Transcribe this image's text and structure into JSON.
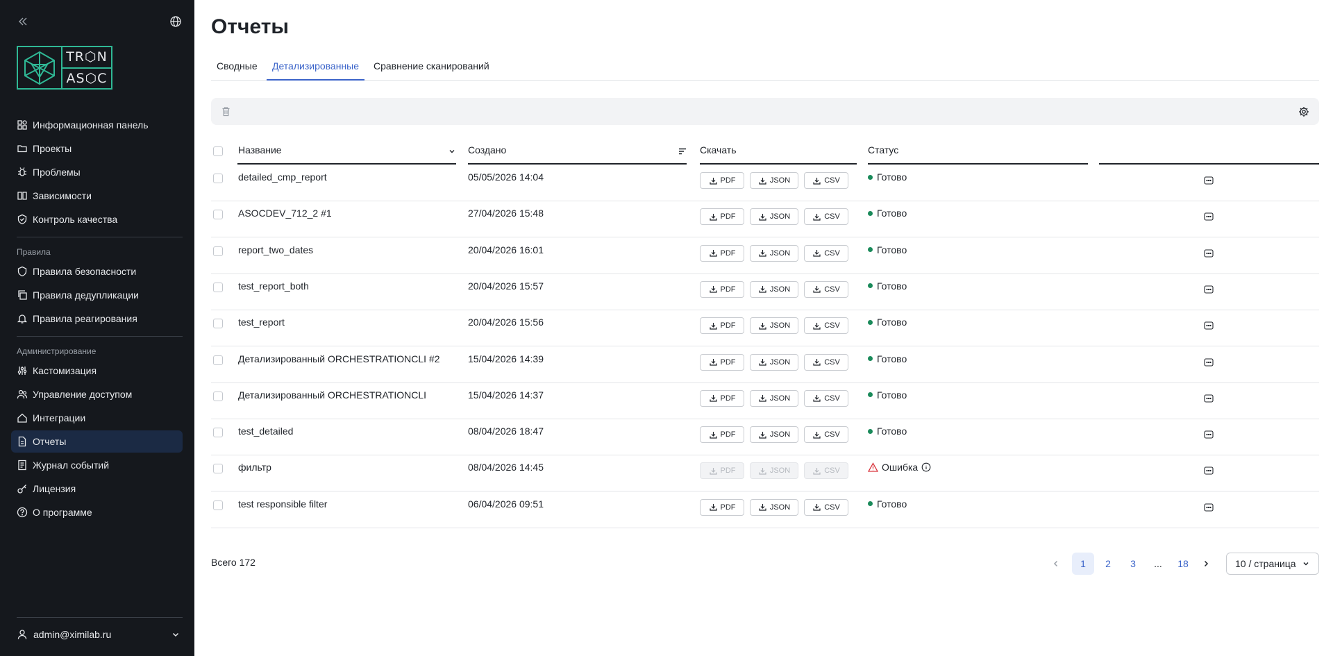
{
  "sidebar": {
    "logo": {
      "line1": "TR⬡N",
      "line2": "AS⬡C"
    },
    "items": [
      {
        "label": "Информационная панель",
        "icon": "dashboard-icon"
      },
      {
        "label": "Проекты",
        "icon": "folder-icon"
      },
      {
        "label": "Проблемы",
        "icon": "bug-icon"
      },
      {
        "label": "Зависимости",
        "icon": "book-icon"
      },
      {
        "label": "Контроль качества",
        "icon": "shield-check-icon"
      }
    ],
    "rules_section": "Правила",
    "rules": [
      {
        "label": "Правила безопасности",
        "icon": "shield-icon"
      },
      {
        "label": "Правила дедупликации",
        "icon": "copy-icon"
      },
      {
        "label": "Правила реагирования",
        "icon": "bell-icon"
      }
    ],
    "admin_section": "Администрирование",
    "admin": [
      {
        "label": "Кастомизация",
        "icon": "sliders-icon"
      },
      {
        "label": "Управление доступом",
        "icon": "users-icon"
      },
      {
        "label": "Интеграции",
        "icon": "home-icon"
      },
      {
        "label": "Отчеты",
        "icon": "report-icon",
        "active": true
      },
      {
        "label": "Журнал событий",
        "icon": "journal-icon"
      },
      {
        "label": "Лицензия",
        "icon": "key-icon"
      },
      {
        "label": "О программе",
        "icon": "help-icon"
      }
    ],
    "user": "admin@ximilab.ru"
  },
  "page": {
    "title": "Отчеты",
    "tabs": [
      "Сводные",
      "Детализированные",
      "Сравнение сканирований"
    ],
    "active_tab": 1
  },
  "table": {
    "headers": {
      "name": "Название",
      "created": "Создано",
      "download": "Скачать",
      "status": "Статус"
    },
    "download_labels": {
      "pdf": "PDF",
      "json": "JSON",
      "csv": "CSV"
    },
    "rows": [
      {
        "name": "detailed_cmp_report",
        "created": "05/05/2026 14:04",
        "status": "Готово",
        "ok": true
      },
      {
        "name": "ASOCDEV_712_2 #1",
        "created": "27/04/2026 15:48",
        "status": "Готово",
        "ok": true
      },
      {
        "name": "report_two_dates",
        "created": "20/04/2026 16:01",
        "status": "Готово",
        "ok": true
      },
      {
        "name": "test_report_both",
        "created": "20/04/2026 15:57",
        "status": "Готово",
        "ok": true
      },
      {
        "name": "test_report",
        "created": "20/04/2026 15:56",
        "status": "Готово",
        "ok": true
      },
      {
        "name": "Детализированный ORCHESTRATIONCLI #2",
        "created": "15/04/2026 14:39",
        "status": "Готово",
        "ok": true
      },
      {
        "name": "Детализированный ORCHESTRATIONCLI",
        "created": "15/04/2026 14:37",
        "status": "Готово",
        "ok": true
      },
      {
        "name": "test_detailed",
        "created": "08/04/2026 18:47",
        "status": "Готово",
        "ok": true
      },
      {
        "name": "фильтр",
        "created": "08/04/2026 14:45",
        "status": "Ошибка",
        "ok": false
      },
      {
        "name": "test responsible filter",
        "created": "06/04/2026 09:51",
        "status": "Готово",
        "ok": true
      }
    ]
  },
  "pagination": {
    "total": "Всего 172",
    "pages": [
      "1",
      "2",
      "3",
      "...",
      "18"
    ],
    "current": "1",
    "page_size": "10 / страница"
  },
  "colors": {
    "sidebar_bg": "#15181d",
    "accent": "#3a63c9",
    "success": "#1a8a5a",
    "error": "#d9363e",
    "logo": "#2fb895"
  }
}
